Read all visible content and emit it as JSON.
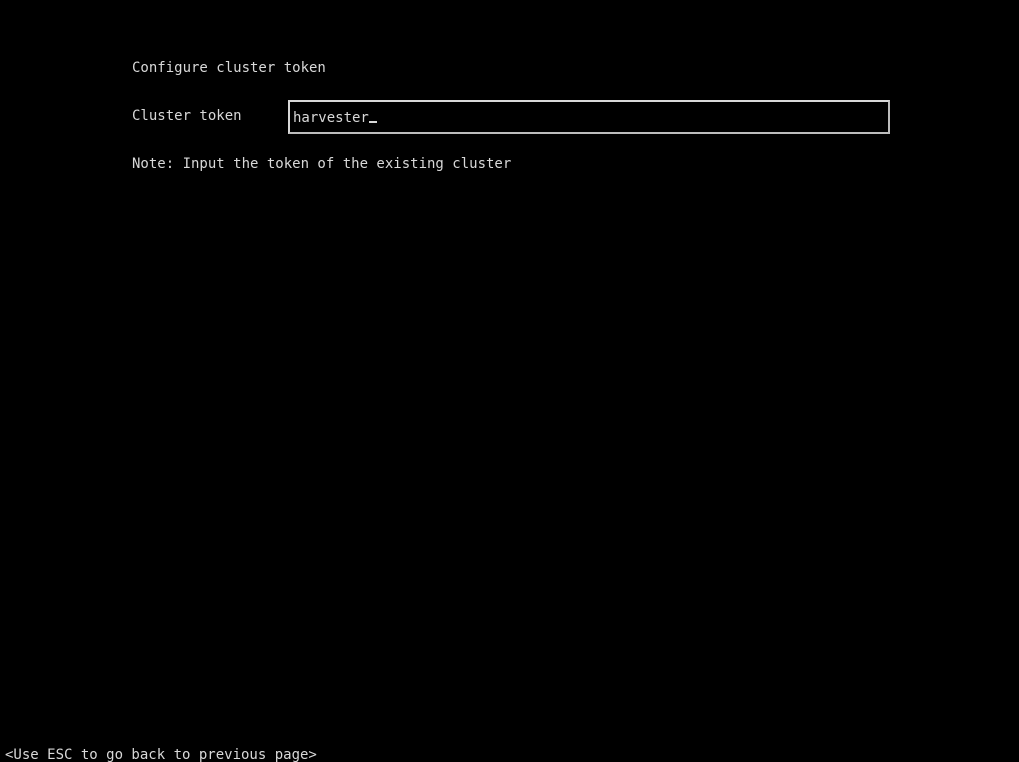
{
  "screen": {
    "title": "Configure cluster token",
    "background_color": "#000000",
    "text_color": "#d8d8d8"
  },
  "token_field": {
    "label": "Cluster token",
    "value": "harvester",
    "focused": true
  },
  "note": "Note: Input the token of the existing cluster",
  "footer": {
    "hint": "<Use ESC to go back to previous page>"
  }
}
